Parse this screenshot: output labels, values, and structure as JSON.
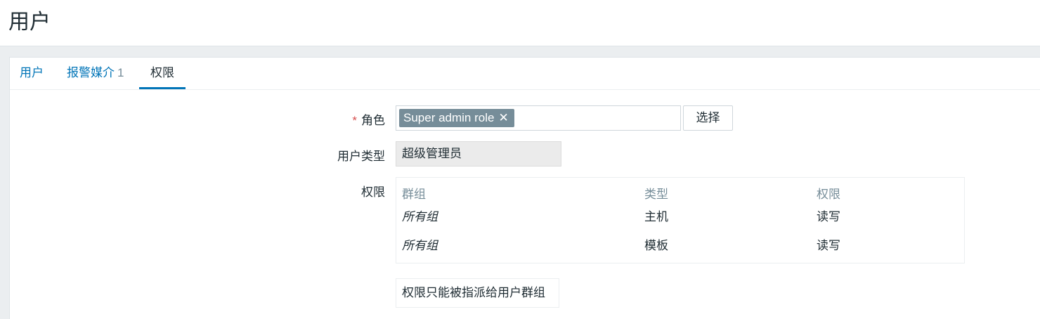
{
  "page": {
    "title": "用户"
  },
  "tabs": [
    {
      "label": "用户",
      "count": "",
      "active": false
    },
    {
      "label": "报警媒介",
      "count": "1",
      "active": false
    },
    {
      "label": "权限",
      "count": "",
      "active": true
    }
  ],
  "form": {
    "role": {
      "required_mark": "*",
      "label": "角色",
      "selected_chip": "Super admin role",
      "select_button": "选择"
    },
    "user_type": {
      "label": "用户类型",
      "value": "超级管理员"
    },
    "permissions": {
      "label": "权限",
      "columns": [
        "群组",
        "类型",
        "权限"
      ],
      "rows": [
        {
          "group": "所有组",
          "type": "主机",
          "permission": "读写"
        },
        {
          "group": "所有组",
          "type": "模板",
          "permission": "读写"
        }
      ],
      "note": "权限只能被指派给用户群组"
    }
  },
  "colors": {
    "link": "#0275b8",
    "chip_bg": "#768d99",
    "required": "#d64e4e",
    "background": "#ebeef0"
  }
}
